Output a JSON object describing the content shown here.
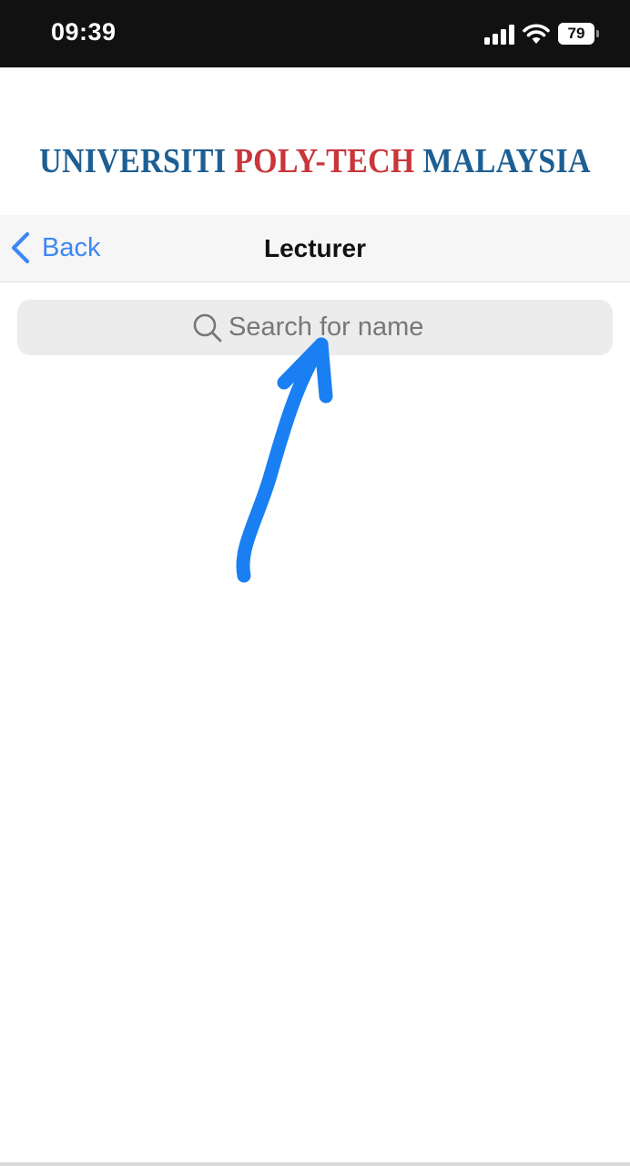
{
  "status_bar": {
    "time": "09:39",
    "battery_level": "79",
    "battery_percent": 79,
    "signal_icon": "cellular-signal-icon",
    "wifi_icon": "wifi-icon"
  },
  "header": {
    "logo_word_1": "UNIVERSITI",
    "logo_word_2": "POLY-TECH",
    "logo_word_3": "MALAYSIA",
    "logo_colors": {
      "blue": "#1d5f93",
      "red": "#c9353a"
    }
  },
  "nav": {
    "back_label": "Back",
    "back_icon": "chevron-left-icon",
    "title": "Lecturer",
    "accent_color": "#3e87f4"
  },
  "search": {
    "placeholder": "Search for name",
    "value": "",
    "icon": "search-icon"
  },
  "annotation": {
    "icon": "hand-drawn-arrow-icon",
    "color": "#1a7ff2"
  }
}
